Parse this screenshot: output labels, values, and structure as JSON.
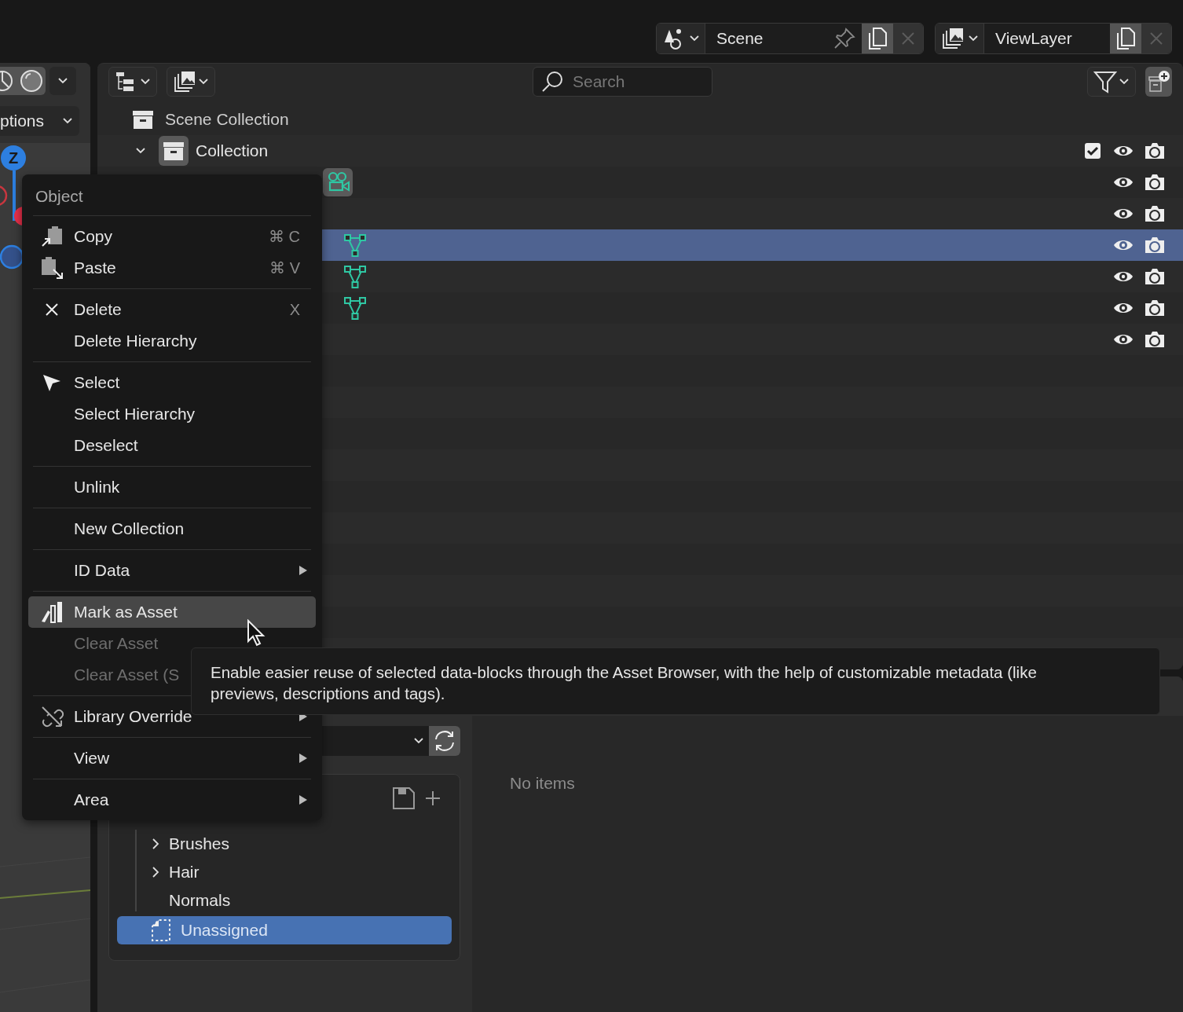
{
  "header": {
    "scene": {
      "value": "Scene"
    },
    "view_layer": {
      "value": "ViewLayer"
    }
  },
  "viewport": {
    "options_label": "ptions",
    "gizmo_axis": "Z"
  },
  "outliner": {
    "search": {
      "placeholder": "Search"
    },
    "rows": [
      {
        "kind": "scene_collection",
        "label": "Scene Collection",
        "selected": false
      },
      {
        "kind": "collection",
        "label": "Collection",
        "selected": false,
        "expanded": true,
        "checked": true
      },
      {
        "kind": "camera",
        "selected": false
      },
      {
        "kind": "object",
        "selected": false
      },
      {
        "kind": "mesh",
        "selected": true
      },
      {
        "kind": "mesh",
        "selected": false
      },
      {
        "kind": "mesh",
        "selected": false
      },
      {
        "kind": "object",
        "selected": false
      }
    ]
  },
  "menu": {
    "title": "Object",
    "groups": [
      [
        {
          "label": "Copy",
          "kind": "copy",
          "shortcut": "⌘ C",
          "submenu": false,
          "disabled": false,
          "selected": false
        },
        {
          "label": "Paste",
          "kind": "paste",
          "shortcut": "⌘ V",
          "submenu": false,
          "disabled": false,
          "selected": false
        }
      ],
      [
        {
          "label": "Delete",
          "kind": "delete",
          "shortcut": "X",
          "submenu": false,
          "disabled": false,
          "selected": false
        },
        {
          "label": "Delete Hierarchy",
          "submenu": false,
          "disabled": false,
          "selected": false
        }
      ],
      [
        {
          "label": "Select",
          "kind": "select",
          "submenu": false,
          "disabled": false,
          "selected": false
        },
        {
          "label": "Select Hierarchy",
          "submenu": false,
          "disabled": false,
          "selected": false
        },
        {
          "label": "Deselect",
          "submenu": false,
          "disabled": false,
          "selected": false
        }
      ],
      [
        {
          "label": "Unlink",
          "submenu": false,
          "disabled": false,
          "selected": false
        }
      ],
      [
        {
          "label": "New Collection",
          "submenu": false,
          "disabled": false,
          "selected": false
        }
      ],
      [
        {
          "label": "ID Data",
          "submenu": true,
          "disabled": false,
          "selected": false
        }
      ],
      [
        {
          "label": "Mark as Asset",
          "kind": "asset",
          "submenu": false,
          "disabled": false,
          "selected": true
        },
        {
          "label": "Clear Asset",
          "submenu": false,
          "disabled": true,
          "selected": false
        },
        {
          "label": "Clear Asset (S",
          "submenu": false,
          "disabled": true,
          "selected": false
        }
      ],
      [
        {
          "label": "Library Override",
          "kind": "override",
          "submenu": true,
          "disabled": false,
          "selected": false
        }
      ],
      [
        {
          "label": "View",
          "submenu": true,
          "disabled": false,
          "selected": false
        }
      ],
      [
        {
          "label": "Area",
          "submenu": true,
          "disabled": false,
          "selected": false
        }
      ]
    ]
  },
  "tooltip": {
    "text": "Enable easier reuse of selected data-blocks through the Asset Browser, with the help of customizable metadata (like previews, descriptions and tags)."
  },
  "asset_browser": {
    "catalogs": [
      {
        "kind": "catalog",
        "label": "Brushes",
        "expanded": false,
        "has_children": true,
        "selected": false
      },
      {
        "kind": "catalog",
        "label": "Hair",
        "expanded": false,
        "has_children": true,
        "selected": false
      },
      {
        "kind": "catalog",
        "label": "Normals",
        "has_children": false,
        "selected": false
      },
      {
        "kind": "unassigned",
        "label": "Unassigned",
        "selected": true
      }
    ],
    "empty_message": "No items"
  }
}
